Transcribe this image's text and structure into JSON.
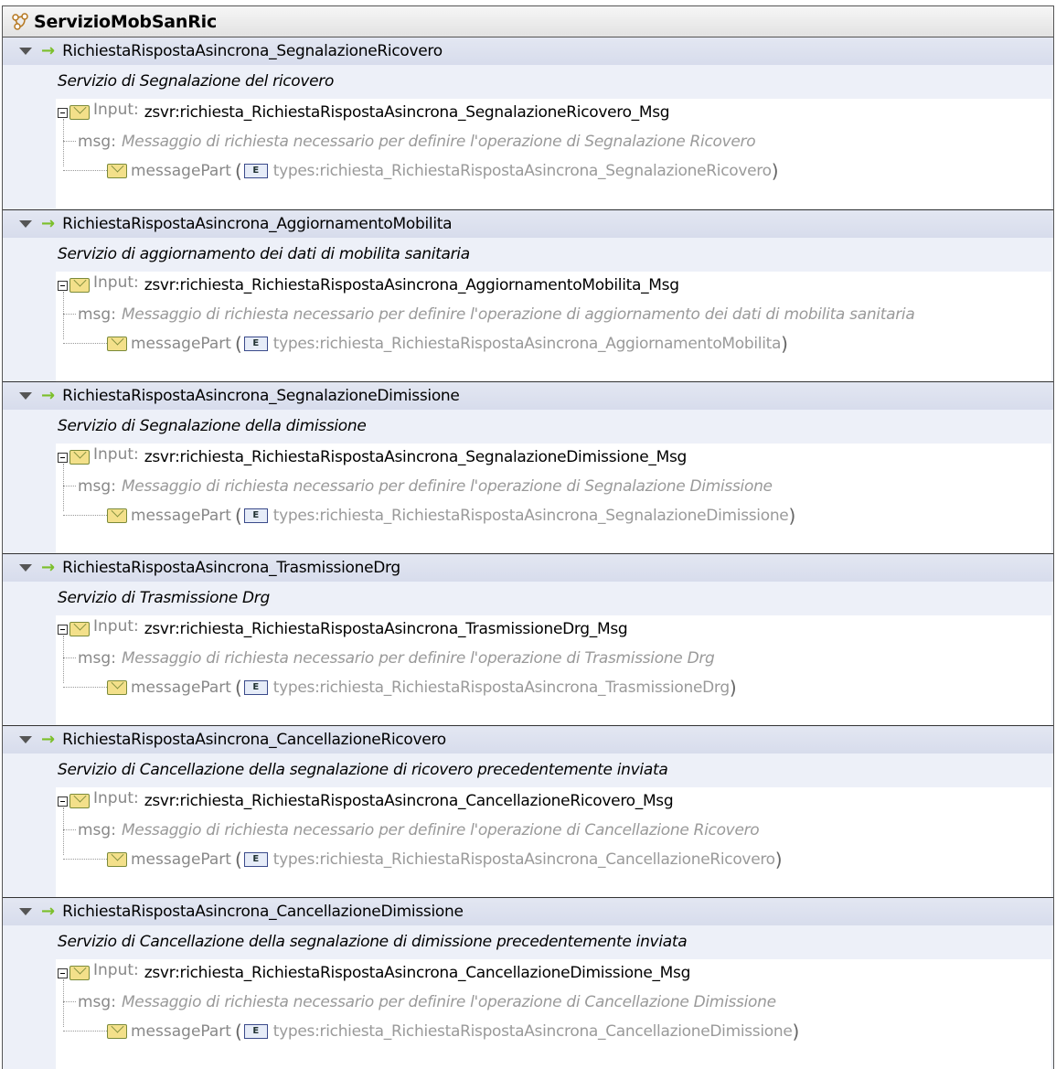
{
  "service": {
    "name": "ServizioMobSanRic",
    "icon": "service-network-icon"
  },
  "labels": {
    "input": "Input:",
    "msg": "msg:",
    "message_part": "messagePart",
    "element_badge": "E",
    "open_paren": "(",
    "close_paren": ")"
  },
  "operations": [
    {
      "name": "RichiestaRispostaAsincrona_SegnalazioneRicovero",
      "description": "Servizio di Segnalazione del ricovero",
      "input": "zsvr:richiesta_RichiestaRispostaAsincrona_SegnalazioneRicovero_Msg",
      "msg": "Messaggio di richiesta necessario per definire l'operazione di Segnalazione Ricovero",
      "type": "types:richiesta_RichiestaRispostaAsincrona_SegnalazioneRicovero"
    },
    {
      "name": "RichiestaRispostaAsincrona_AggiornamentoMobilita",
      "description": "Servizio di aggiornamento dei dati di mobilita sanitaria",
      "input": "zsvr:richiesta_RichiestaRispostaAsincrona_AggiornamentoMobilita_Msg",
      "msg": "Messaggio di richiesta necessario per definire l'operazione di aggiornamento dei dati di mobilita sanitaria",
      "type": "types:richiesta_RichiestaRispostaAsincrona_AggiornamentoMobilita"
    },
    {
      "name": "RichiestaRispostaAsincrona_SegnalazioneDimissione",
      "description": "Servizio di Segnalazione della dimissione",
      "input": "zsvr:richiesta_RichiestaRispostaAsincrona_SegnalazioneDimissione_Msg",
      "msg": "Messaggio di richiesta necessario per definire l'operazione di Segnalazione Dimissione",
      "type": "types:richiesta_RichiestaRispostaAsincrona_SegnalazioneDimissione"
    },
    {
      "name": "RichiestaRispostaAsincrona_TrasmissioneDrg",
      "description": "Servizio di Trasmissione Drg",
      "input": "zsvr:richiesta_RichiestaRispostaAsincrona_TrasmissioneDrg_Msg",
      "msg": "Messaggio di richiesta necessario per definire l'operazione di Trasmissione Drg",
      "type": "types:richiesta_RichiestaRispostaAsincrona_TrasmissioneDrg"
    },
    {
      "name": "RichiestaRispostaAsincrona_CancellazioneRicovero",
      "description": "Servizio di Cancellazione della segnalazione di ricovero precedentemente inviata",
      "input": "zsvr:richiesta_RichiestaRispostaAsincrona_CancellazioneRicovero_Msg",
      "msg": "Messaggio di richiesta necessario per definire l'operazione di Cancellazione Ricovero",
      "type": "types:richiesta_RichiestaRispostaAsincrona_CancellazioneRicovero"
    },
    {
      "name": "RichiestaRispostaAsincrona_CancellazioneDimissione",
      "description": "Servizio di Cancellazione della segnalazione di dimissione precedentemente inviata",
      "input": "zsvr:richiesta_RichiestaRispostaAsincrona_CancellazioneDimissione_Msg",
      "msg": "Messaggio di richiesta necessario per definire l'operazione di Cancellazione Dimissione",
      "type": "types:richiesta_RichiestaRispostaAsincrona_CancellazioneDimissione"
    }
  ]
}
